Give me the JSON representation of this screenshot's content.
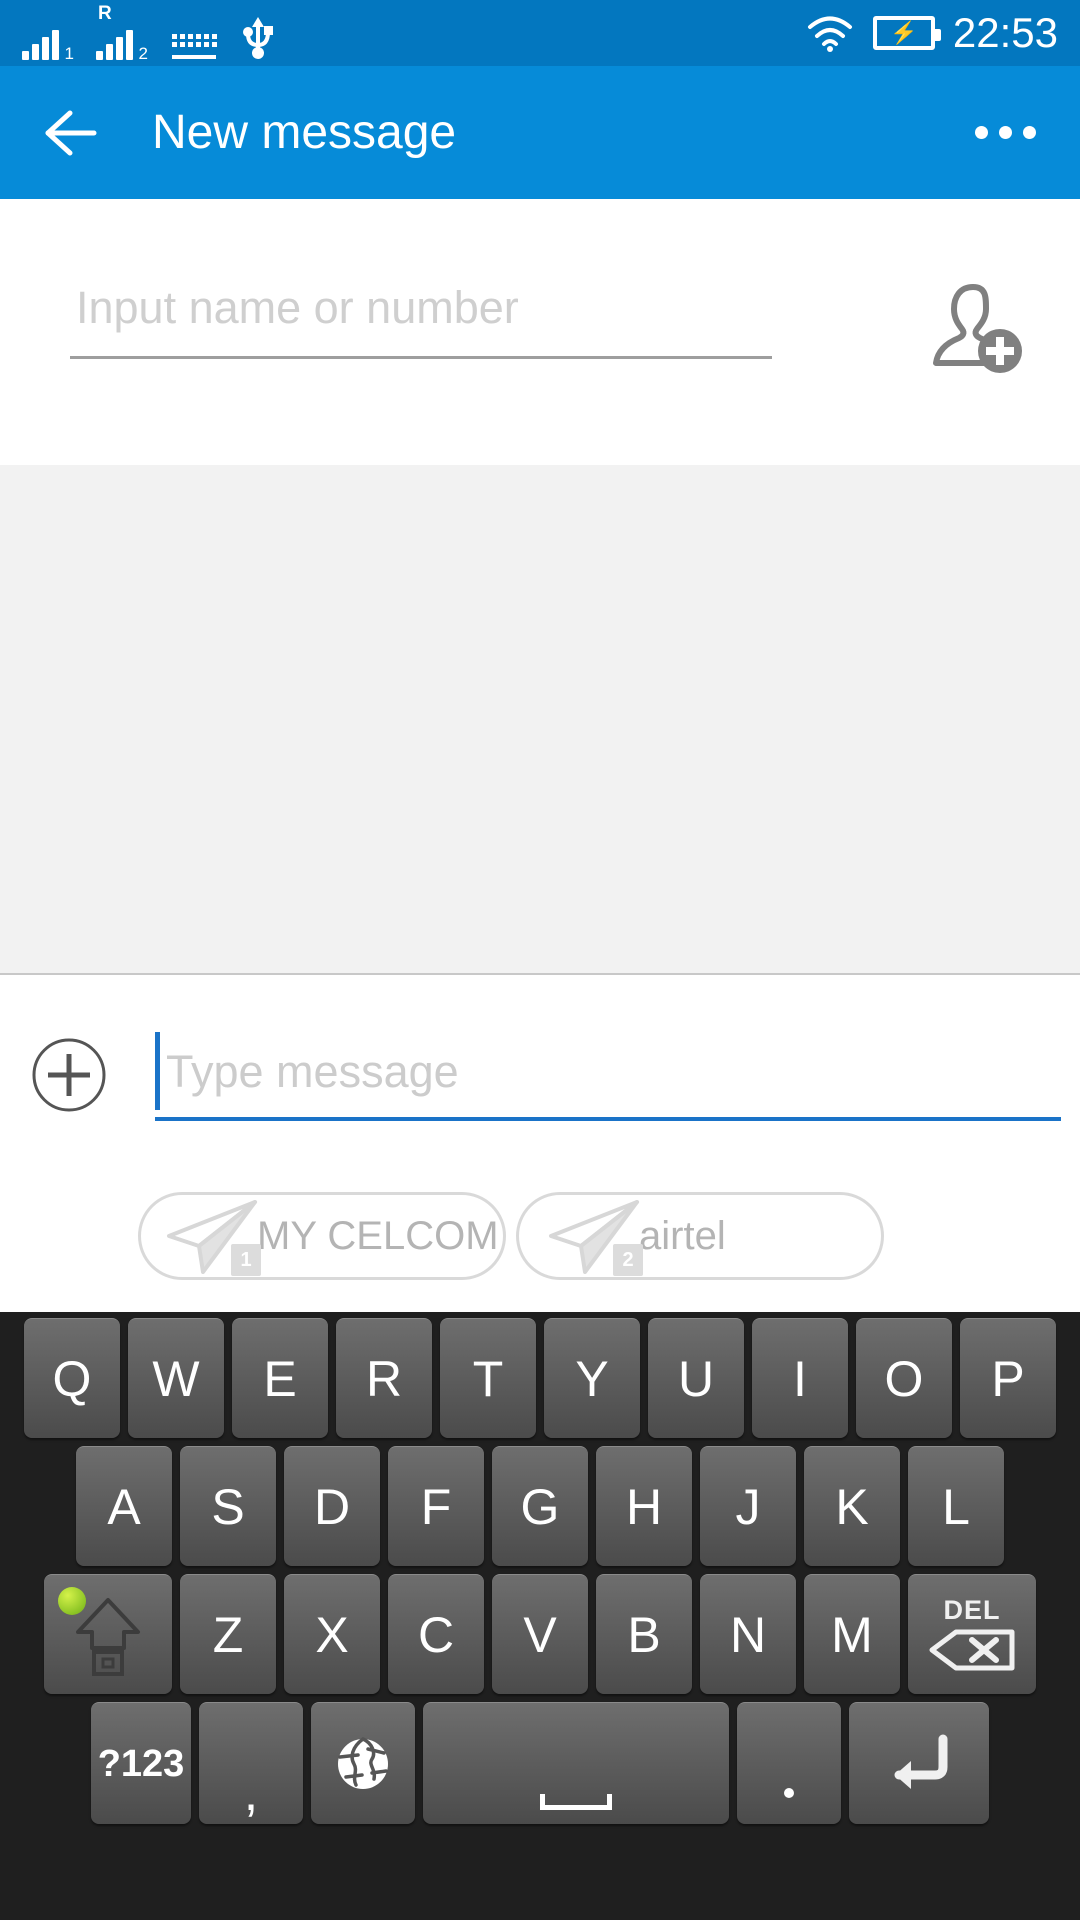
{
  "status_bar": {
    "sim1_label": "1",
    "sim1_roaming": "",
    "sim2_label": "2",
    "sim2_roaming": "R",
    "icons": [
      "signal-sim1-icon",
      "signal-sim2-icon",
      "keyboard-icon",
      "usb-icon",
      "wifi-icon",
      "battery-charging-icon"
    ],
    "time": "22:53",
    "background": "#0377bf"
  },
  "app_bar": {
    "title": "New message",
    "back_icon": "arrow-left-icon",
    "overflow_icon": "more-options-icon",
    "background": "#068bd8"
  },
  "recipient": {
    "placeholder": "Input name or number",
    "value": "",
    "add_contact_icon": "add-contact-icon"
  },
  "conversation": {
    "messages": [],
    "background": "#f2f2f2"
  },
  "compose": {
    "attach_icon": "plus-circle-icon",
    "message_placeholder": "Type message",
    "message_value": "",
    "accent": "#1a73c8",
    "send_buttons": [
      {
        "label": "MY CELCOM",
        "sim": "1",
        "icon": "send-plane-icon"
      },
      {
        "label": "airtel",
        "sim": "2",
        "icon": "send-plane-icon"
      }
    ]
  },
  "keyboard": {
    "background": "#1f1f1f",
    "caps_lock_on": true,
    "row1": [
      "Q",
      "W",
      "E",
      "R",
      "T",
      "Y",
      "U",
      "I",
      "O",
      "P"
    ],
    "row2": [
      "A",
      "S",
      "D",
      "F",
      "G",
      "H",
      "J",
      "K",
      "L"
    ],
    "row3_letters": [
      "Z",
      "X",
      "C",
      "V",
      "B",
      "N",
      "M"
    ],
    "shift_label": "",
    "shift_icon": "shift-up-icon",
    "del_label": "DEL",
    "del_icon": "backspace-icon",
    "row4": {
      "symbols_label": "?123",
      "comma_label": ",",
      "globe_icon": "globe-language-icon",
      "space_label": "",
      "space_icon": "space-bar-icon",
      "period_label": ".",
      "enter_icon": "enter-return-icon"
    }
  }
}
